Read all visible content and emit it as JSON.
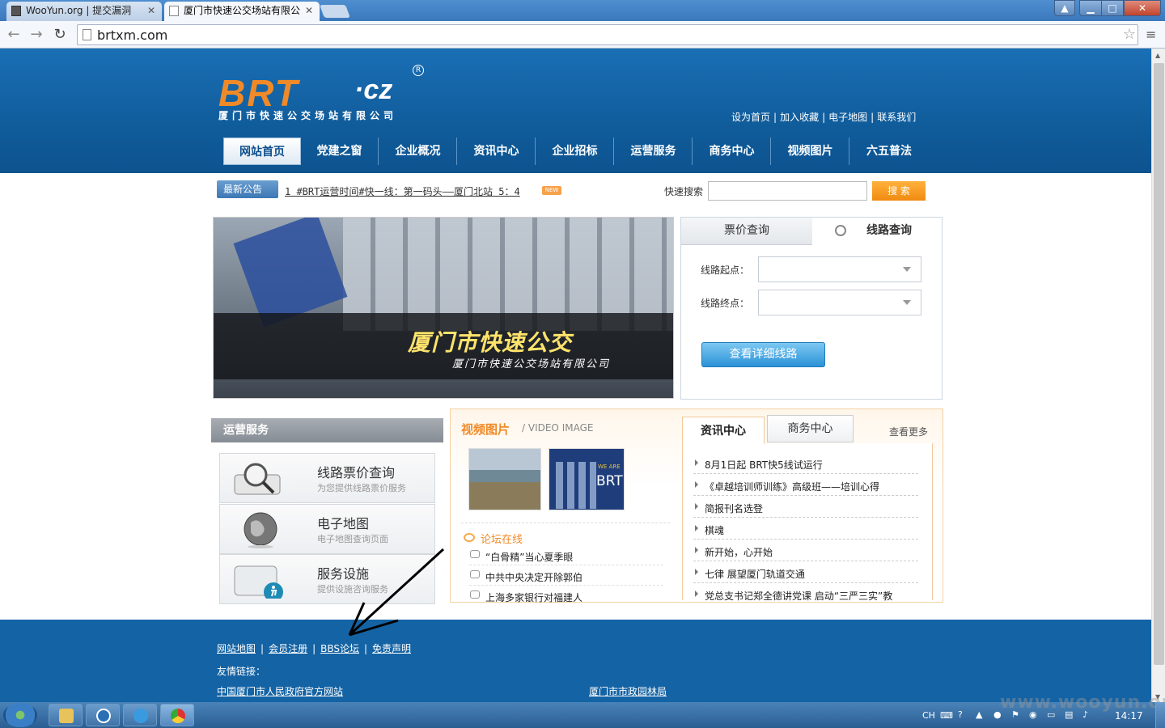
{
  "browser": {
    "tabs": [
      {
        "label": "WooYun.org | 提交漏洞"
      },
      {
        "label": "厦门市快速公交场站有限公"
      }
    ],
    "url": "brtxm.com"
  },
  "header": {
    "logo_brt": "BRT",
    "logo_cz": "·cz",
    "logo_reg": "R",
    "logo_subtitle": "厦门市快速公交场站有限公司",
    "top_links": [
      "设为首页",
      "加入收藏",
      "电子地图",
      "联系我们"
    ],
    "nav": [
      "网站首页",
      "党建之窗",
      "企业概况",
      "资讯中心",
      "企业招标",
      "运营服务",
      "商务中心",
      "视频图片",
      "六五普法"
    ]
  },
  "notice": {
    "badge": "最新公告",
    "text": "1 #BRT运营时间#快一线：第一码头——厦门北站 5：4",
    "new_badge": "NEW",
    "search_label": "快速搜索",
    "search_btn": "搜 索"
  },
  "banner": {
    "title": "厦门市快速公交",
    "subtitle": "厦门市快速公交场站有限公司"
  },
  "route_query": {
    "tab_fare": "票价查询",
    "tab_route": "线路查询",
    "start_label": "线路起点：",
    "end_label": "线路终点：",
    "button": "查看详细线路"
  },
  "ops_services": {
    "title": "运营服务",
    "items": [
      {
        "title": "线路票价查询",
        "desc": "为您提供线路票价服务"
      },
      {
        "title": "电子地图",
        "desc": "电子地图查询页面"
      },
      {
        "title": "服务设施",
        "desc": "提供设施咨询服务"
      }
    ]
  },
  "video": {
    "title": "视频图片",
    "subtitle": "/ VIDEO IMAGE",
    "thumb2_top": "WE ARE",
    "thumb2_big": "BRT"
  },
  "forum": {
    "title": "论坛在线",
    "items": [
      "“白骨精”当心夏季眼",
      "中共中央决定开除郭伯",
      "上海多家银行对福建人"
    ]
  },
  "news": {
    "tab1": "资讯中心",
    "tab2": "商务中心",
    "more": "查看更多",
    "items": [
      "8月1日起 BRT快5线试运行",
      "《卓越培训师训练》高级班——培训心得",
      "简报刊名选登",
      "棋魂",
      "新开始，心开始",
      "七律 展望厦门轨道交通",
      "党总支书记郑全德讲党课 启动“三严三实”教"
    ]
  },
  "footer": {
    "links": [
      "网站地图",
      "会员注册",
      "BBS论坛",
      "免责声明"
    ],
    "friend_label": "友情链接：",
    "friend_links": [
      "中国厦门市人民政府官方网站",
      "厦门市市政园林局"
    ]
  },
  "taskbar": {
    "lang": "CH",
    "clock": "14:17"
  },
  "watermark": "www.wooyun.org",
  "colors": {
    "header_blue": "#0f5a98",
    "accent_orange": "#f08a28",
    "footer_blue": "#1463a4"
  }
}
